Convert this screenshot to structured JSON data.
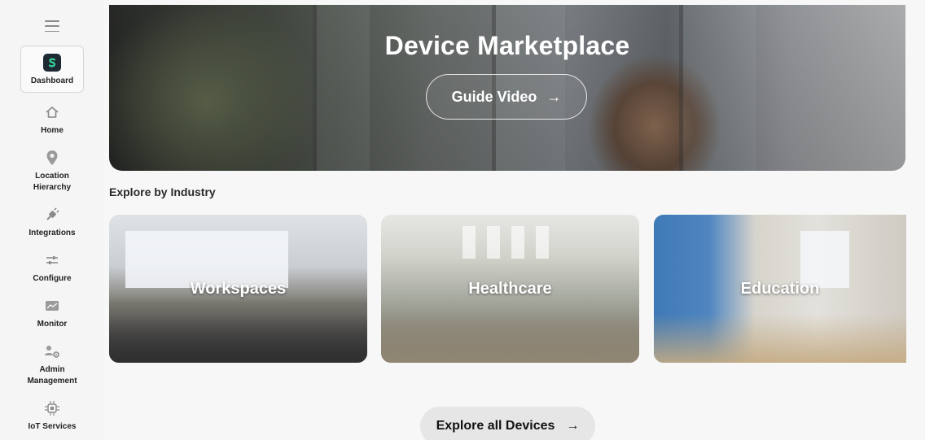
{
  "sidebar": {
    "items": [
      {
        "label": "Dashboard",
        "icon": "dashboard-logo-icon",
        "active": true
      },
      {
        "label": "Home",
        "icon": "home-icon"
      },
      {
        "label": "Location Hierarchy",
        "icon": "location-pin-icon"
      },
      {
        "label": "Integrations",
        "icon": "plug-icon"
      },
      {
        "label": "Configure",
        "icon": "sliders-icon"
      },
      {
        "label": "Monitor",
        "icon": "monitor-chart-icon"
      },
      {
        "label": "Admin Management",
        "icon": "admin-gear-icon"
      },
      {
        "label": "IoT Services",
        "icon": "chip-icon"
      }
    ]
  },
  "hero": {
    "title": "Device Marketplace",
    "guide_button": "Guide Video",
    "arrow": "→"
  },
  "industry": {
    "section_title": "Explore by Industry",
    "cards": [
      {
        "label": "Workspaces"
      },
      {
        "label": "Healthcare"
      },
      {
        "label": "Education"
      }
    ]
  },
  "explore_all": {
    "label": "Explore all Devices",
    "arrow": "→"
  },
  "colors": {
    "sidebar_bg": "#f5f5f5",
    "main_bg": "#f7f7f7",
    "button_bg": "#e6e6e6",
    "accent_logo": "#1e2a33"
  }
}
